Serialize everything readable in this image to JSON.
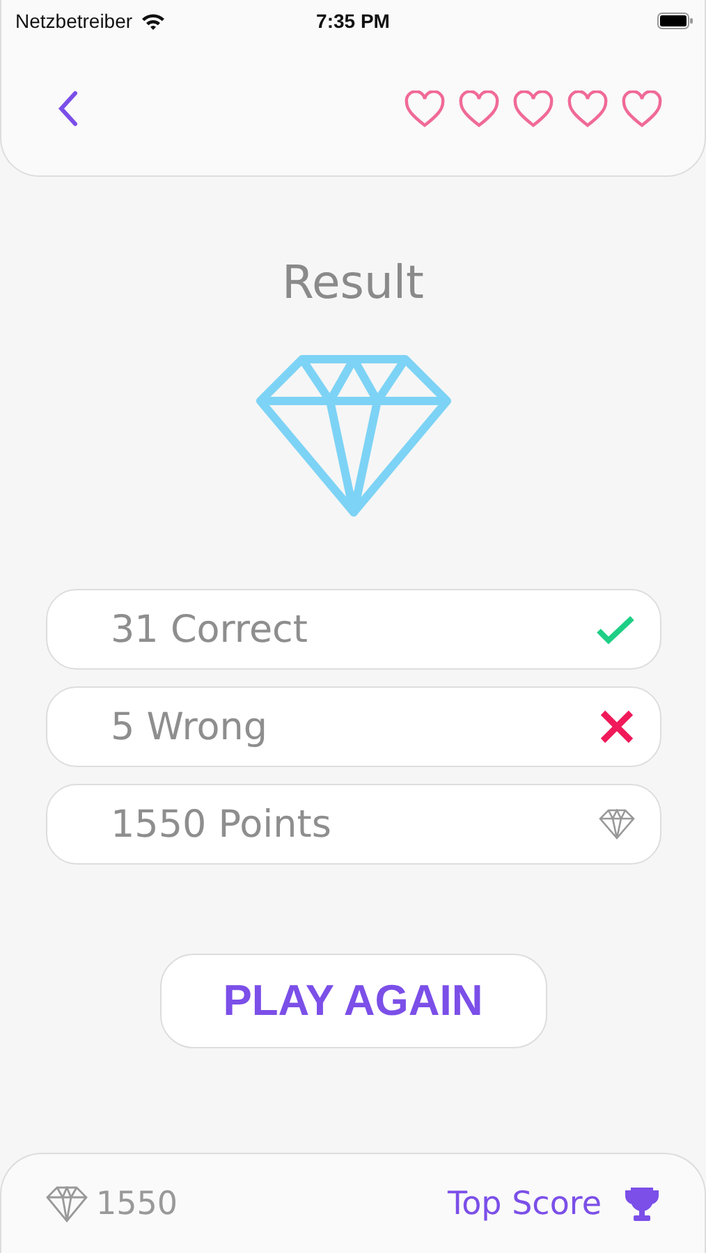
{
  "status_bar": {
    "carrier": "Netzbetreiber",
    "time": "7:35 PM"
  },
  "header": {
    "hearts": [
      {
        "filled": false
      },
      {
        "filled": false
      },
      {
        "filled": false
      },
      {
        "filled": false
      },
      {
        "filled": false
      }
    ]
  },
  "title": "Result",
  "results": [
    {
      "kind": "correct",
      "text": "31 Correct"
    },
    {
      "kind": "wrong",
      "text": "5 Wrong"
    },
    {
      "kind": "points",
      "text": "1550 Points"
    }
  ],
  "play_button": "PLAY AGAIN",
  "footer": {
    "gems": "1550",
    "top_score": "Top Score"
  }
}
